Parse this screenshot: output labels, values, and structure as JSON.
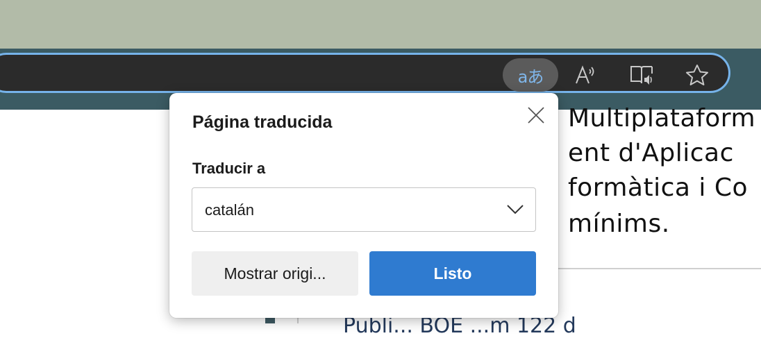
{
  "browser": {
    "toolbar_icons": [
      "translate-icon",
      "read-aloud-icon",
      "immersive-reader-icon",
      "favorite-star-icon"
    ],
    "translate_glyph": "aあ",
    "accent_color": "#76b3ea"
  },
  "page": {
    "lines": [
      "Multiplataform",
      "ent d'Aplicac",
      "formàtica i Co",
      "mínims."
    ],
    "bottom_fragment": "Publi...  BOE ...m   122  d"
  },
  "translate_popup": {
    "title": "Página traducida",
    "translate_to_label": "Traducir a",
    "selected_language": "catalán",
    "show_original_label": "Mostrar origi...",
    "done_label": "Listo",
    "primary_color": "#2f7bd0"
  }
}
